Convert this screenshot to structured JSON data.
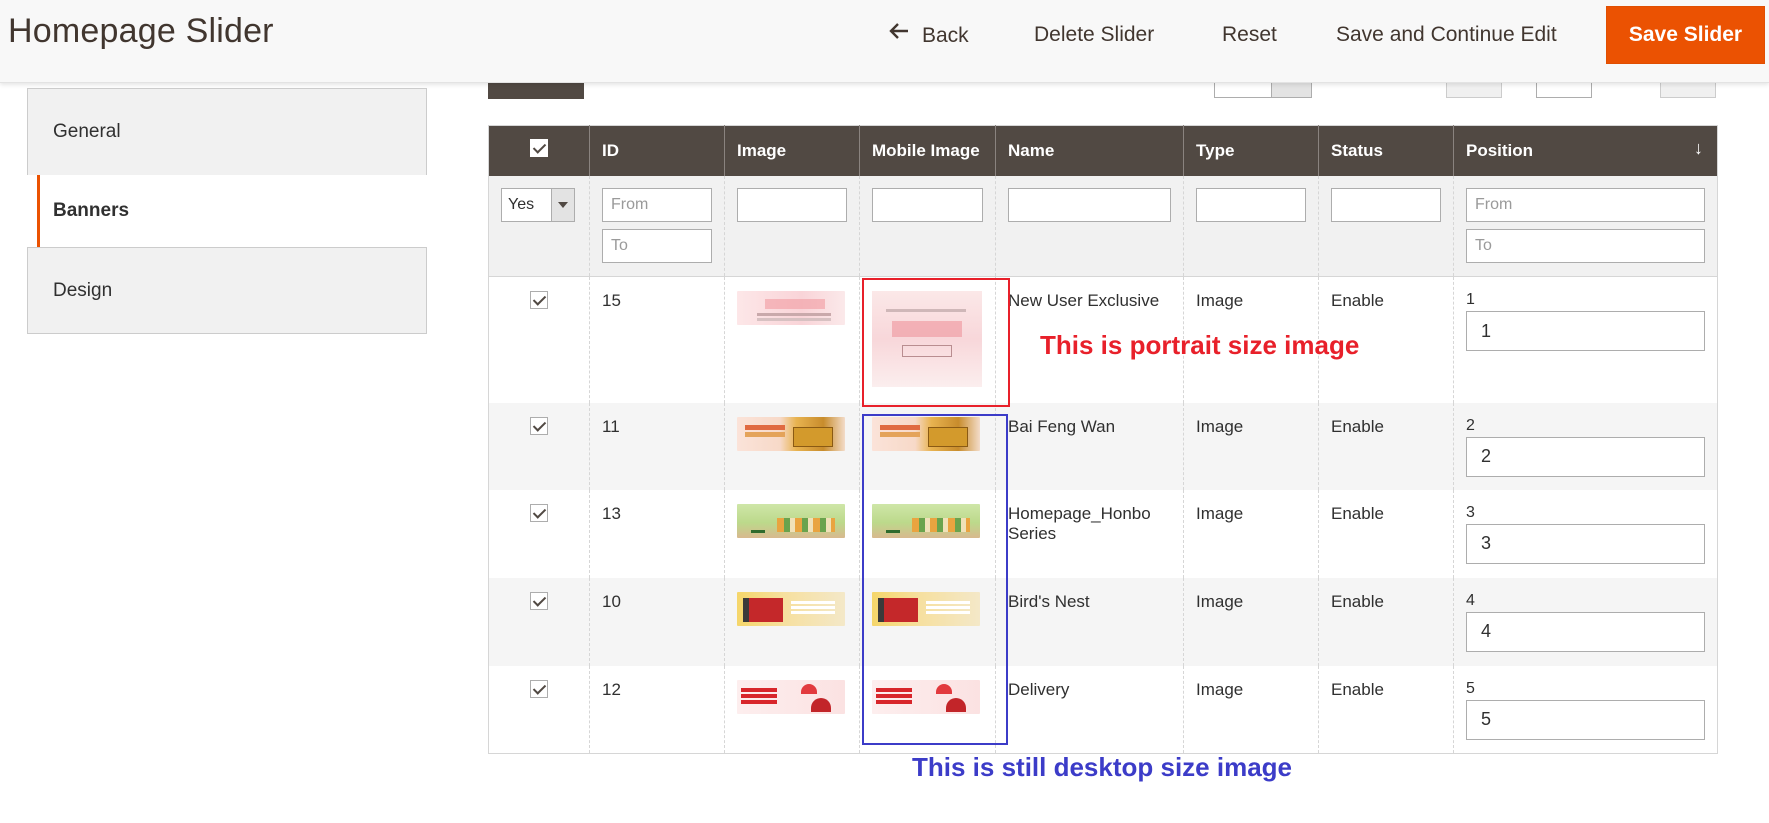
{
  "header": {
    "title": "Homepage Slider",
    "back_label": "Back",
    "delete_label": "Delete Slider",
    "reset_label": "Reset",
    "save_continue_label": "Save and Continue Edit",
    "save_label": "Save Slider"
  },
  "colors": {
    "accent": "#eb5202",
    "header_bg": "#514943",
    "annotation_red": "#e8202a",
    "annotation_blue": "#3c3cc8"
  },
  "sidebar": {
    "items": [
      {
        "label": "General",
        "active": false
      },
      {
        "label": "Banners",
        "active": true
      },
      {
        "label": "Design",
        "active": false
      }
    ]
  },
  "grid": {
    "columns": [
      "ID",
      "Image",
      "Mobile Image",
      "Name",
      "Type",
      "Status",
      "Position"
    ],
    "filters": {
      "select_value": "Yes",
      "id_from_placeholder": "From",
      "id_to_placeholder": "To",
      "position_from_placeholder": "From",
      "position_to_placeholder": "To"
    },
    "rows": [
      {
        "id": "15",
        "name": "New User Exclusive",
        "type": "Image",
        "status": "Enable",
        "position": "1",
        "position_value": "1"
      },
      {
        "id": "11",
        "name": "Bai Feng Wan",
        "type": "Image",
        "status": "Enable",
        "position": "2",
        "position_value": "2"
      },
      {
        "id": "13",
        "name": "Homepage_Honbo Series",
        "type": "Image",
        "status": "Enable",
        "position": "3",
        "position_value": "3"
      },
      {
        "id": "10",
        "name": "Bird's Nest",
        "type": "Image",
        "status": "Enable",
        "position": "4",
        "position_value": "4"
      },
      {
        "id": "12",
        "name": "Delivery",
        "type": "Image",
        "status": "Enable",
        "position": "5",
        "position_value": "5"
      }
    ]
  },
  "annotations": {
    "portrait": "This is portrait size image",
    "desktop": "This is still desktop size image"
  }
}
